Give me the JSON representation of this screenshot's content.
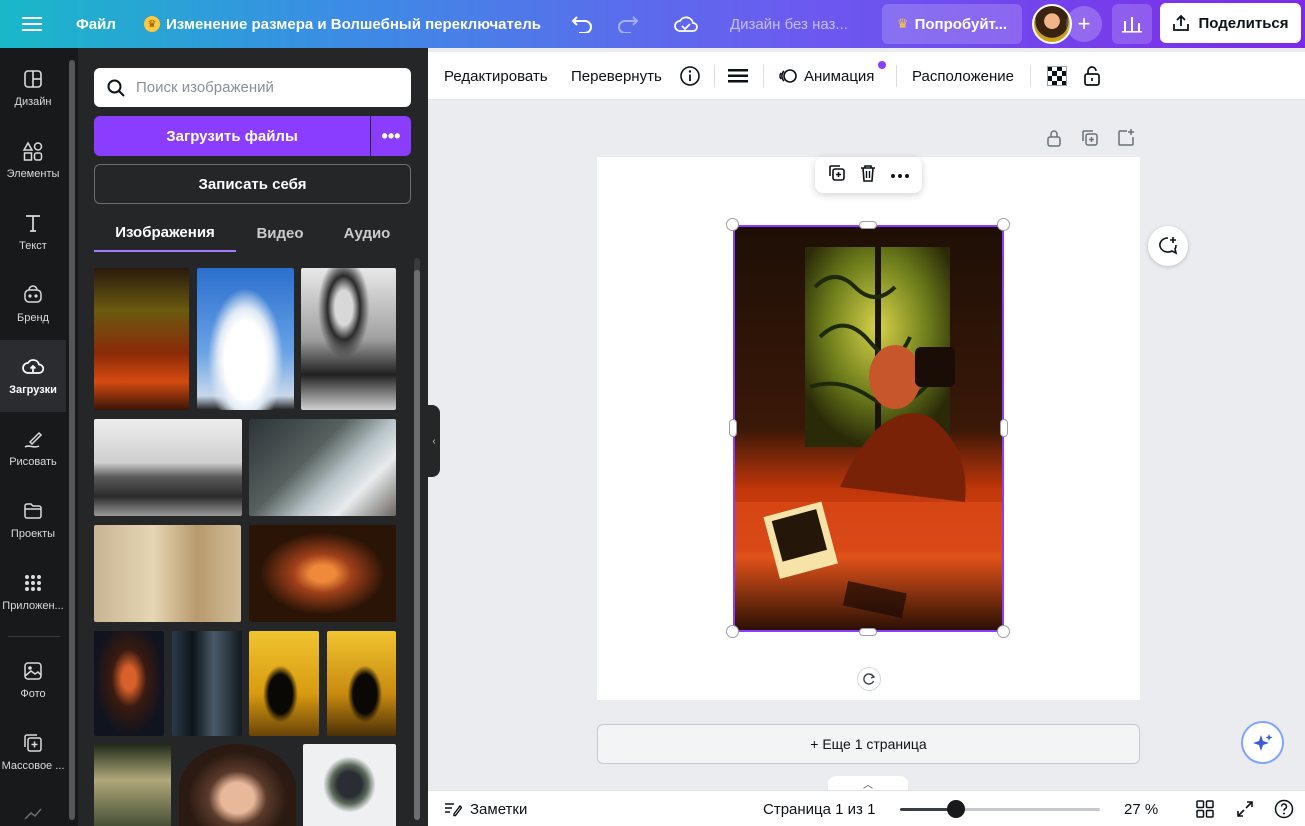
{
  "topbar": {
    "file_label": "Файл",
    "title": "Изменение размера и Волшебный переключатель",
    "design_name": "Дизайн без наз...",
    "try_label": "Попробуйт...",
    "share_label": "Поделиться",
    "plus_label": "+"
  },
  "rail": {
    "items": [
      {
        "label": "Дизайн",
        "icon": "layout-icon"
      },
      {
        "label": "Элементы",
        "icon": "shapes-icon"
      },
      {
        "label": "Текст",
        "icon": "text-icon"
      },
      {
        "label": "Бренд",
        "icon": "brand-icon"
      },
      {
        "label": "Загрузки",
        "icon": "cloud-upload-icon"
      },
      {
        "label": "Рисовать",
        "icon": "draw-icon"
      },
      {
        "label": "Проекты",
        "icon": "folder-icon"
      },
      {
        "label": "Приложен...",
        "icon": "apps-icon"
      },
      {
        "label": "Фото",
        "icon": "photo-icon"
      },
      {
        "label": "Массовое ...",
        "icon": "bulk-create-icon"
      }
    ]
  },
  "panel": {
    "search_placeholder": "Поиск изображений",
    "upload_label": "Загрузить файлы",
    "more_label": "•••",
    "record_label": "Записать себя",
    "tabs": [
      "Изображения",
      "Видео",
      "Аудио"
    ]
  },
  "context_toolbar": {
    "edit": "Редактировать",
    "flip": "Перевернуть",
    "animate": "Анимация",
    "position": "Расположение"
  },
  "canvas": {
    "add_page": "+ Еще 1 страница"
  },
  "bottombar": {
    "notes": "Заметки",
    "page_indicator": "Страница 1 из 1",
    "zoom": "27 %",
    "zoom_level": 0.27
  },
  "colors": {
    "accent": "#8b3dff",
    "rail_bg": "#18191b",
    "panel_bg": "#252627"
  }
}
